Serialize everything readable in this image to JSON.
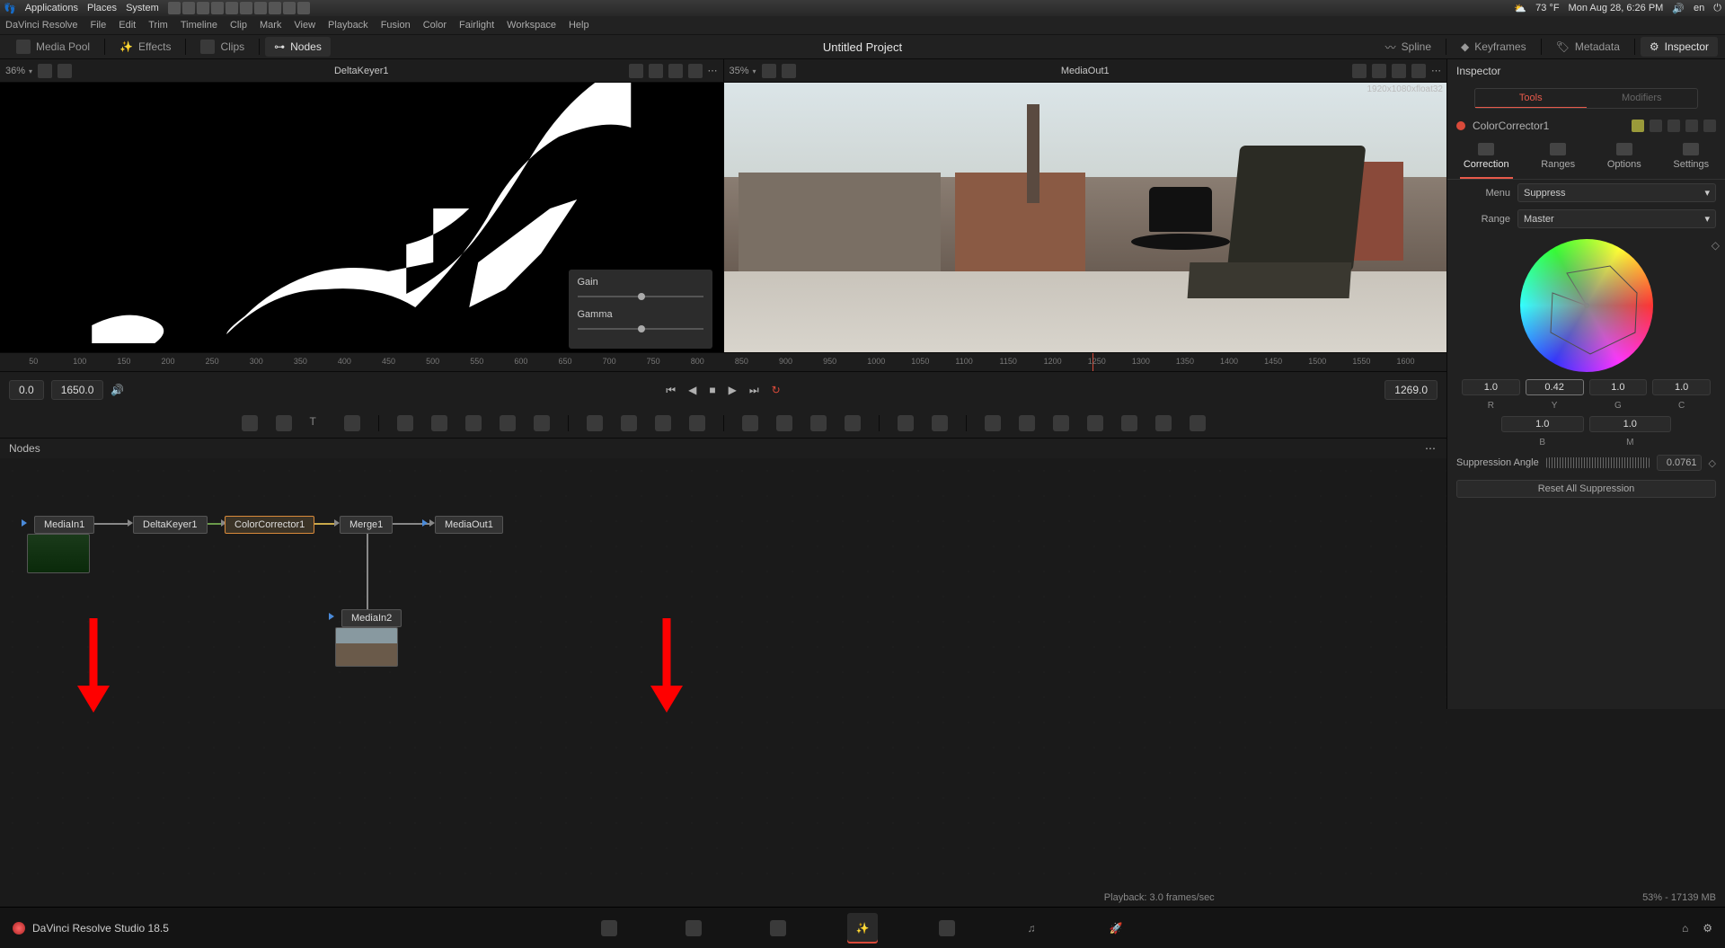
{
  "os": {
    "menus": [
      "Applications",
      "Places",
      "System"
    ],
    "weather": "73 °F",
    "clock": "Mon Aug 28,  6:26 PM",
    "lang": "en"
  },
  "app_menu": [
    "DaVinci Resolve",
    "File",
    "Edit",
    "Trim",
    "Timeline",
    "Clip",
    "Mark",
    "View",
    "Playback",
    "Fusion",
    "Color",
    "Fairlight",
    "Workspace",
    "Help"
  ],
  "sections": {
    "left": [
      {
        "label": "Media Pool",
        "icon": "media-pool-icon"
      },
      {
        "label": "Effects",
        "icon": "effects-icon"
      },
      {
        "label": "Clips",
        "icon": "clips-icon"
      },
      {
        "label": "Nodes",
        "icon": "nodes-icon",
        "active": true
      }
    ],
    "right": [
      {
        "label": "Spline",
        "icon": "spline-icon"
      },
      {
        "label": "Keyframes",
        "icon": "keyframes-icon"
      },
      {
        "label": "Metadata",
        "icon": "metadata-icon"
      },
      {
        "label": "Inspector",
        "icon": "inspector-icon",
        "active": true
      }
    ],
    "title": "Untitled Project"
  },
  "viewers": {
    "left": {
      "zoom": "36%",
      "name": "DeltaKeyer1"
    },
    "right": {
      "zoom": "35%",
      "name": "MediaOut1",
      "resolution": "1920x1080xfloat32"
    }
  },
  "gain_panel": {
    "gain": "Gain",
    "gamma": "Gamma"
  },
  "ruler": {
    "ticks": [
      "50",
      "100",
      "150",
      "200",
      "250",
      "300",
      "350",
      "400",
      "450",
      "500",
      "550",
      "600",
      "650",
      "700",
      "750",
      "800",
      "850",
      "900",
      "950",
      "1000",
      "1050",
      "1100",
      "1150",
      "1200",
      "1250",
      "1300",
      "1350",
      "1400",
      "1450",
      "1500",
      "1550",
      "1600"
    ],
    "playhead": 1269
  },
  "transport": {
    "start": "0.0",
    "end": "1650.0",
    "current": "1269.0"
  },
  "nodes_panel_label": "Nodes",
  "nodes": {
    "MediaIn1": "MediaIn1",
    "DeltaKeyer1": "DeltaKeyer1",
    "ColorCorrector1": "ColorCorrector1",
    "Merge1": "Merge1",
    "MediaOut1": "MediaOut1",
    "MediaIn2": "MediaIn2"
  },
  "inspector": {
    "header": "Inspector",
    "tabs": {
      "tools": "Tools",
      "modifiers": "Modifiers"
    },
    "node": "ColorCorrector1",
    "subtabs": {
      "correction": "Correction",
      "ranges": "Ranges",
      "options": "Options",
      "settings": "Settings"
    },
    "menu": {
      "label": "Menu",
      "value": "Suppress"
    },
    "range": {
      "label": "Range",
      "value": "Master"
    },
    "rgb": {
      "row1": [
        "1.0",
        "0.42",
        "1.0",
        "1.0"
      ],
      "row1_lbl": [
        "R",
        "Y",
        "G",
        "C"
      ],
      "row2": [
        "1.0",
        "1.0"
      ],
      "row2_lbl": [
        "B",
        "M"
      ]
    },
    "suppression": {
      "label": "Suppression Angle",
      "value": "0.0761"
    },
    "reset": "Reset All Suppression"
  },
  "status": {
    "playback": "Playback: 3.0 frames/sec",
    "mem": "53% - 17139 MB"
  },
  "brand": "DaVinci Resolve Studio 18.5"
}
